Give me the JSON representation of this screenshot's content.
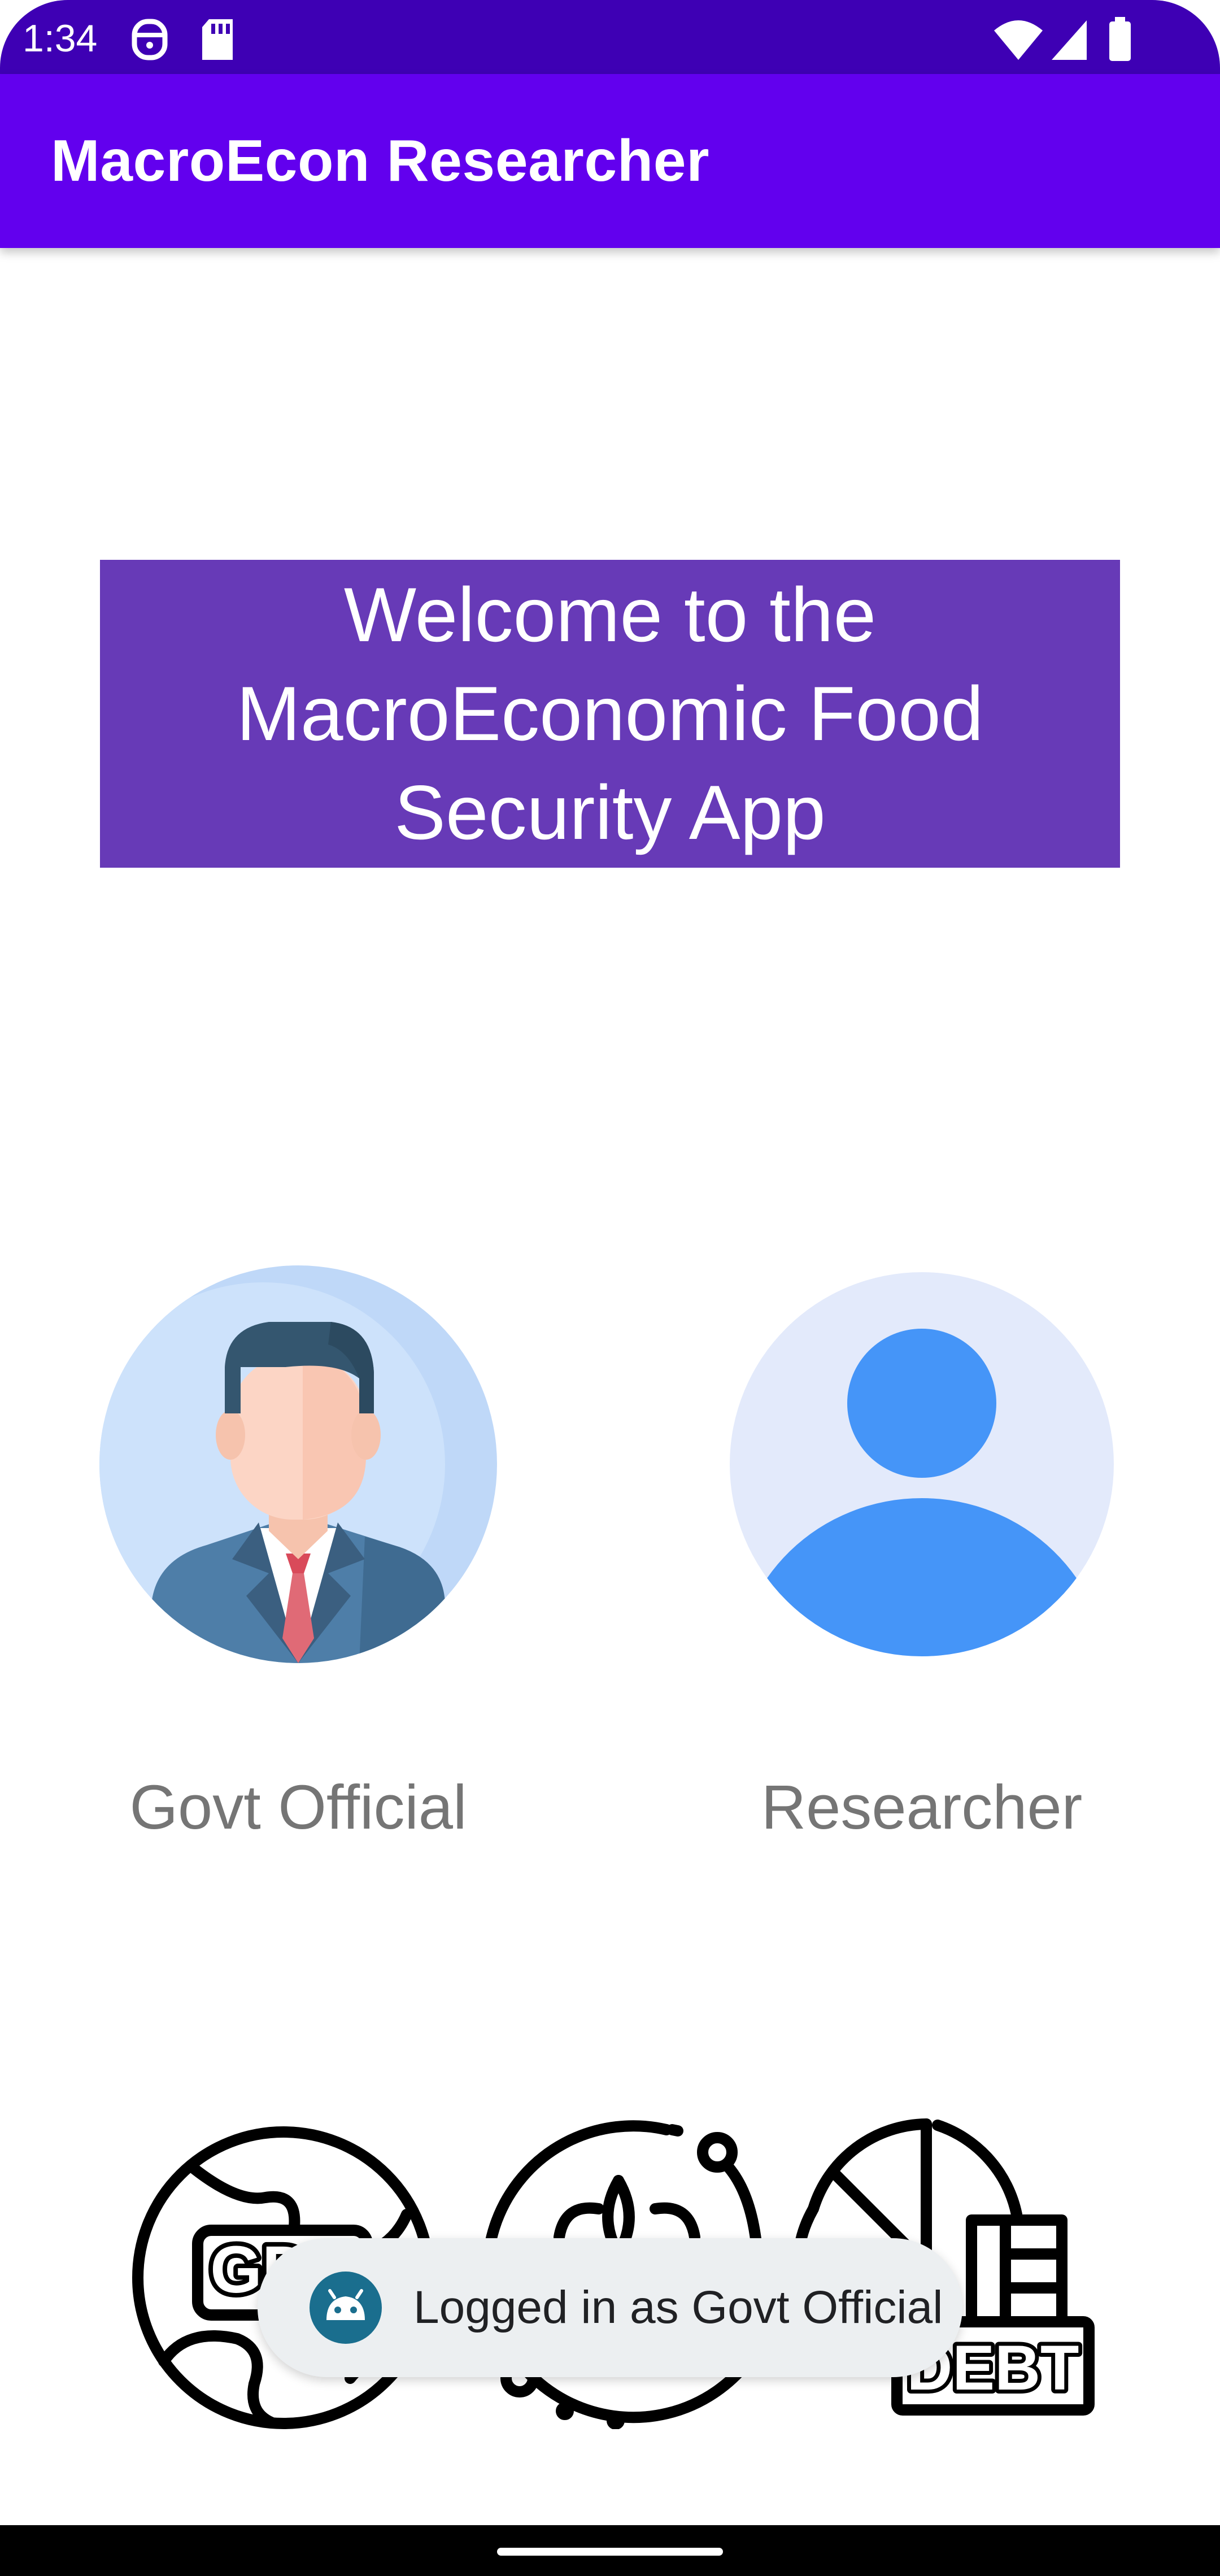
{
  "status_bar": {
    "time": "1:34",
    "left_icons": [
      "face-icon",
      "sd-card-icon"
    ],
    "right_icons": [
      "wifi-icon",
      "signal-icon",
      "battery-icon"
    ]
  },
  "app_bar": {
    "title": "MacroEcon Researcher"
  },
  "welcome": {
    "text": "Welcome to the MacroEconomic Food Security App"
  },
  "roles": [
    {
      "label": "Govt Official",
      "icon": "govt-official-avatar-icon"
    },
    {
      "label": "Researcher",
      "icon": "researcher-avatar-icon"
    }
  ],
  "bottom_icons": {
    "gdp_text": "GDP",
    "debt_text": "DEBT",
    "icons": [
      "gdp-globe-icon",
      "agriculture-plant-icon",
      "debt-chart-icon"
    ]
  },
  "toast": {
    "text": "Logged in as Govt Official",
    "icon": "android-icon"
  },
  "colors": {
    "status_bar": "#3e00b4",
    "app_bar": "#6200ee",
    "banner": "#673ab7",
    "role_label": "#757575",
    "toast_bg": "#eceff1"
  }
}
